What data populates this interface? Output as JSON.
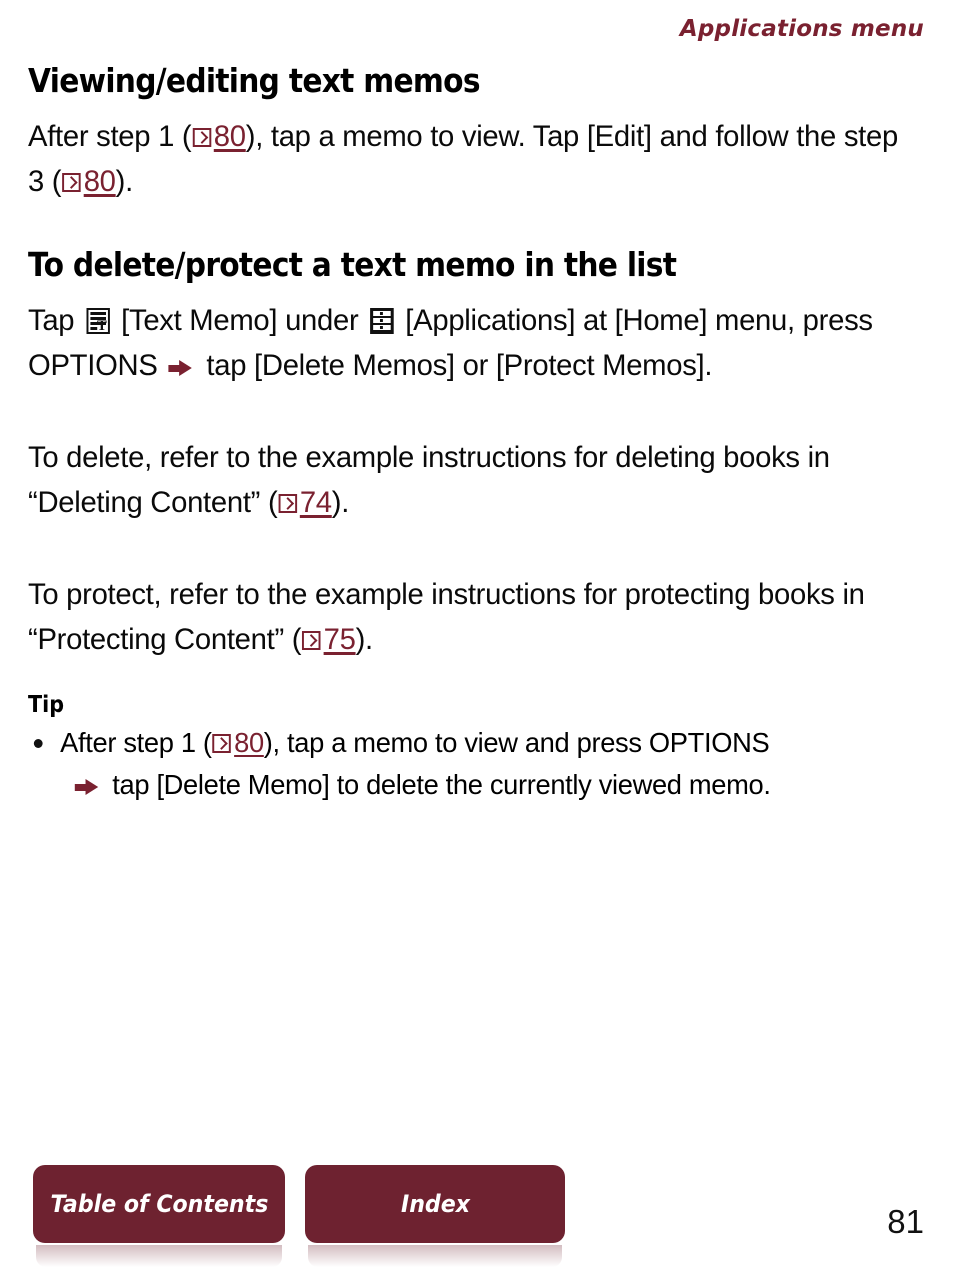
{
  "header": {
    "running_title": "Applications menu",
    "accent_color": "#7A2130"
  },
  "sections": [
    {
      "heading": "Viewing/editing text memos",
      "paragraph_parts": {
        "p1_a": "After step 1 (",
        "p1_ref1": "80",
        "p1_b": "), tap a memo to view. Tap [Edit] and follow the step 3 (",
        "p1_ref2": "80",
        "p1_c": ")."
      }
    },
    {
      "heading": "To delete/protect a text memo in the list",
      "paragraph_parts": {
        "p2_a": "Tap ",
        "p2_b": " [Text Memo] under ",
        "p2_c": " [Applications] at [Home] menu, press OPTIONS ",
        "p2_d": " tap [Delete Memos] or [Protect Memos]."
      }
    }
  ],
  "paragraphs": {
    "delete_a": "To delete, refer to the example instructions for deleting books in “Deleting Content” (",
    "delete_ref": "74",
    "delete_b": ").",
    "protect_a": "To protect, refer to the example instructions for protecting books in “Protecting Content” (",
    "protect_ref": "75",
    "protect_b": ")."
  },
  "tip": {
    "heading": "Tip",
    "item_a": "After step 1 (",
    "item_ref": "80",
    "item_b": "), tap a memo to view and press OPTIONS",
    "item_c": " tap [Delete Memo] to delete the currently viewed memo."
  },
  "footer": {
    "toc_label": "Table of Contents",
    "index_label": "Index",
    "button_color": "#6E2230",
    "page_number": "81"
  },
  "icons": {
    "pageref": "page-reference-arrow-box-icon",
    "arrow": "red-right-arrow-icon",
    "text_memo": "text-memo-document-icon",
    "applications": "applications-list-icon"
  }
}
